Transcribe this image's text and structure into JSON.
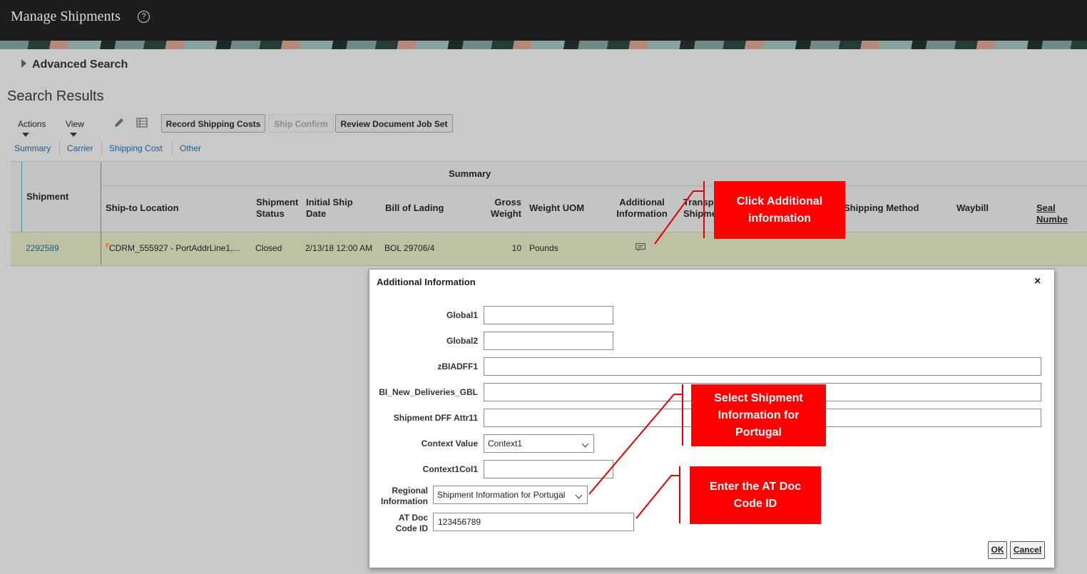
{
  "header": {
    "title": "Manage Shipments",
    "help_icon": "question-circle-icon"
  },
  "advanced_search": {
    "label": "Advanced Search"
  },
  "search_results": {
    "title": "Search Results"
  },
  "toolbar": {
    "actions_label": "Actions",
    "view_label": "View",
    "edit_icon": "pencil-icon",
    "freeze_icon": "freeze-columns-icon",
    "record_shipping_costs": "Record Shipping Costs",
    "ship_confirm": "Ship Confirm",
    "review_document_job_set": "Review Document Job Set"
  },
  "view_tabs": [
    "Summary",
    "Carrier",
    "Shipping Cost",
    "Other"
  ],
  "table": {
    "group_header": "Summary",
    "columns": {
      "shipment": "Shipment",
      "ship_to_location": "Ship-to Location",
      "shipment_status_1": "Shipment",
      "shipment_status_2": "Status",
      "initial_ship_date_1": "Initial Ship",
      "initial_ship_date_2": "Date",
      "bill_of_lading": "Bill of Lading",
      "gross_weight_1": "Gross",
      "gross_weight_2": "Weight",
      "weight_uom": "Weight UOM",
      "additional_information_1": "Additional",
      "additional_information_2": "Information",
      "transport_shipment_1": "Transp",
      "transport_shipment_2": "Shipme",
      "shipping_method": "Shipping Method",
      "waybill": "Waybill",
      "seal_number": "Seal Numbe"
    },
    "row": {
      "shipment": "2292589",
      "ship_to_location": "CDRM_555927 - PortAddrLine1,...",
      "status": "Closed",
      "initial_ship_date": "2/13/18 12:00 AM",
      "bill_of_lading": "BOL 29706/4",
      "gross_weight": "10",
      "weight_uom": "Pounds",
      "additional_info_icon": "additional-information-icon"
    }
  },
  "dialog": {
    "title": "Additional Information",
    "close_label": "×",
    "fields": {
      "global1": {
        "label": "Global1",
        "value": ""
      },
      "global2": {
        "label": "Global2",
        "value": ""
      },
      "zbiadff1": {
        "label": "zBIADFF1",
        "value": ""
      },
      "bi_new_deliveries": {
        "label": "BI_New_Deliveries_GBL",
        "value": ""
      },
      "shipment_dff_attr11": {
        "label": "Shipment DFF Attr11",
        "value": ""
      },
      "context_value": {
        "label": "Context Value",
        "value": "Context1"
      },
      "context1col1": {
        "label": "Context1Col1",
        "value": ""
      },
      "regional_information": {
        "label_1": "Regional",
        "label_2": "Information",
        "value": "Shipment Information for Portugal"
      },
      "at_doc_code_id": {
        "label_1": "AT Doc",
        "label_2": "Code ID",
        "value": "123456789"
      }
    },
    "ok_label": "OK",
    "cancel_label": "Cancel"
  },
  "callouts": {
    "click_additional_1": "Click Additional",
    "click_additional_2": "information",
    "select_shipment_1": "Select Shipment",
    "select_shipment_2": "Information for",
    "select_shipment_3": "Portugal",
    "enter_at_doc_1": "Enter the AT Doc",
    "enter_at_doc_2": "Code ID"
  },
  "colors": {
    "callout": "#ff0000",
    "link": "#1c5c8c",
    "header_bg": "#1d1d1d"
  }
}
